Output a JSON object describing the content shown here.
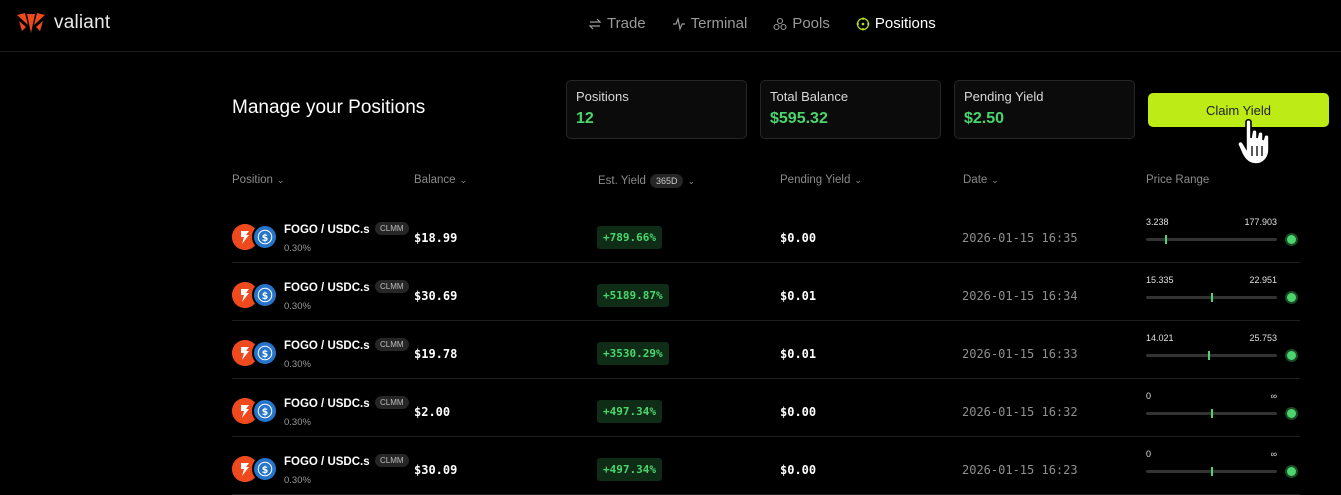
{
  "brand": {
    "name": "valiant",
    "accent": "#ef4a1e"
  },
  "nav": [
    {
      "label": "Trade",
      "icon": "swap-icon",
      "active": false
    },
    {
      "label": "Terminal",
      "icon": "pulse-icon",
      "active": false
    },
    {
      "label": "Pools",
      "icon": "pools-icon",
      "active": false
    },
    {
      "label": "Positions",
      "icon": "target-icon",
      "active": true
    }
  ],
  "page": {
    "title": "Manage your Positions"
  },
  "stats": [
    {
      "label": "Positions",
      "value": "12"
    },
    {
      "label": "Total Balance",
      "value": "$595.32"
    },
    {
      "label": "Pending Yield",
      "value": "$2.50"
    }
  ],
  "claim_button": {
    "label": "Claim Yield",
    "color": "#bdeb16"
  },
  "table": {
    "headers": {
      "position": "Position",
      "balance": "Balance",
      "est_yield": "Est. Yield",
      "est_yield_badge": "365D",
      "pending_yield": "Pending Yield",
      "date": "Date",
      "price_range": "Price Range"
    },
    "rows": [
      {
        "pair": "FOGO / USDC.s",
        "type": "CLMM",
        "fee": "0.30%",
        "balance": "$18.99",
        "est_yield": "+789.66%",
        "pending": "$0.00",
        "date": "2026-01-15 16:35",
        "range_low": "3.238",
        "range_high": "177.903",
        "current_position": 0.15
      },
      {
        "pair": "FOGO / USDC.s",
        "type": "CLMM",
        "fee": "0.30%",
        "balance": "$30.69",
        "est_yield": "+5189.87%",
        "pending": "$0.01",
        "date": "2026-01-15 16:34",
        "range_low": "15.335",
        "range_high": "22.951",
        "current_position": 0.5
      },
      {
        "pair": "FOGO / USDC.s",
        "type": "CLMM",
        "fee": "0.30%",
        "balance": "$19.78",
        "est_yield": "+3530.29%",
        "pending": "$0.01",
        "date": "2026-01-15 16:33",
        "range_low": "14.021",
        "range_high": "25.753",
        "current_position": 0.48
      },
      {
        "pair": "FOGO / USDC.s",
        "type": "CLMM",
        "fee": "0.30%",
        "balance": "$2.00",
        "est_yield": "+497.34%",
        "pending": "$0.00",
        "date": "2026-01-15 16:32",
        "range_low": "0",
        "range_high": "∞",
        "current_position": 0.5
      },
      {
        "pair": "FOGO / USDC.s",
        "type": "CLMM",
        "fee": "0.30%",
        "balance": "$30.09",
        "est_yield": "+497.34%",
        "pending": "$0.00",
        "date": "2026-01-15 16:23",
        "range_low": "0",
        "range_high": "∞",
        "current_position": 0.5
      }
    ]
  }
}
